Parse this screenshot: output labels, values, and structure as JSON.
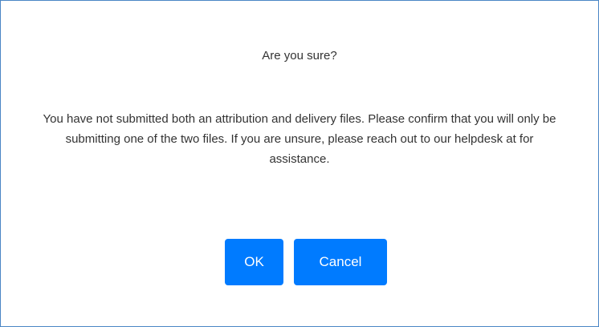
{
  "dialog": {
    "title": "Are you sure?",
    "message": "You have not submitted both an attribution and delivery files. Please confirm that you will only be submitting one of the two files. If you are unsure, please reach out to our helpdesk at for assistance.",
    "ok_label": "OK",
    "cancel_label": "Cancel"
  },
  "colors": {
    "accent": "#007bff",
    "border": "#4a86c5"
  }
}
